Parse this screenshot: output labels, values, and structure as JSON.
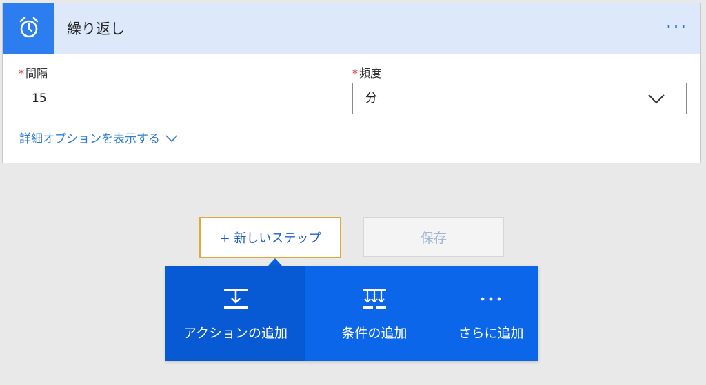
{
  "trigger_card": {
    "title": "繰り返し",
    "more_label": "···",
    "icon": "alarm-clock-icon",
    "fields": [
      {
        "label": "間隔",
        "required_marker": "*",
        "value": "15"
      },
      {
        "label": "頻度",
        "required_marker": "*",
        "value": "分"
      }
    ],
    "advanced_options_label": "詳細オプションを表示する"
  },
  "actions": {
    "new_step_label": "+ 新しいステップ",
    "save_label": "保存"
  },
  "flyout": {
    "items": [
      {
        "label": "アクションの追加",
        "icon": "add-action-icon"
      },
      {
        "label": "条件の追加",
        "icon": "add-condition-icon"
      },
      {
        "label": "さらに追加",
        "icon": "more-icon"
      }
    ]
  },
  "colors": {
    "accent": "#2c7ef0",
    "header_bg": "#dde9fb",
    "flyout_bg": "#0b66ea",
    "flyout_active": "#075ad3",
    "highlight_border": "#e0a83a",
    "required": "#d13438",
    "link": "#2c7dd6"
  }
}
